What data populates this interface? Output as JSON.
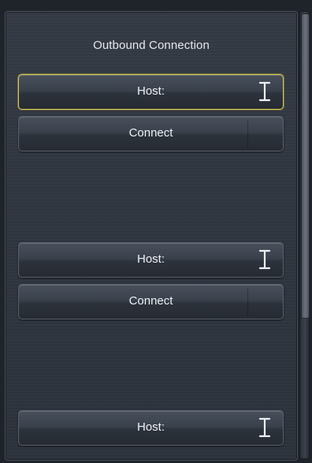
{
  "panel": {
    "title": "Outbound Connection",
    "connections": [
      {
        "host_label": "Host:",
        "connect_label": "Connect",
        "focused": true
      },
      {
        "host_label": "Host:",
        "connect_label": "Connect",
        "focused": false
      },
      {
        "host_label": "Host:",
        "focused": false
      }
    ]
  },
  "icons": {
    "text_cursor": "i-beam-icon"
  },
  "colors": {
    "focus_border": "#d8c84a",
    "panel_bg": "#303640",
    "text": "#eef1f5"
  }
}
